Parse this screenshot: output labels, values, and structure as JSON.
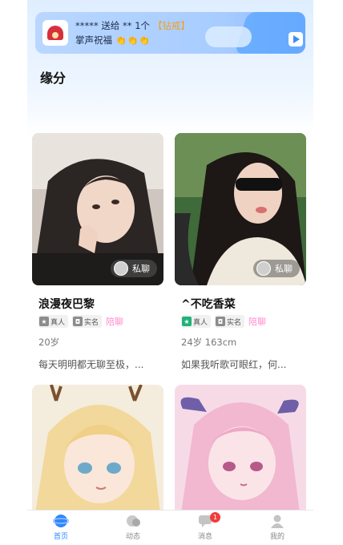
{
  "banner": {
    "line1": "***** 送给 ** 1个",
    "gift_tag": "【钻戒】",
    "line2": "掌声祝福",
    "hands": "👏👏👏"
  },
  "section_title": "缘分",
  "cards": [
    {
      "name": "浪漫夜巴黎",
      "real_label": "真人",
      "id_label": "实名",
      "tag": "陪聊",
      "meta": "20岁",
      "bio": "每天明明都无聊至极，...",
      "chat_label": "私聊"
    },
    {
      "name": "^不吃香菜",
      "real_label": "真人",
      "id_label": "实名",
      "tag": "陪聊",
      "meta": "24岁  163cm",
      "bio": "如果我听歌可眼红，何...",
      "chat_label": "私聊"
    }
  ],
  "tabs": [
    {
      "label": "首页",
      "icon": "home-icon"
    },
    {
      "label": "动态",
      "icon": "moments-icon"
    },
    {
      "label": "消息",
      "icon": "message-icon",
      "badge": "1"
    },
    {
      "label": "我的",
      "icon": "profile-icon"
    }
  ],
  "colors": {
    "accent": "#2f86ff",
    "pink_tag": "#ff8ccf",
    "verified_green": "#20b27a",
    "badge_red": "#f23b3b"
  }
}
